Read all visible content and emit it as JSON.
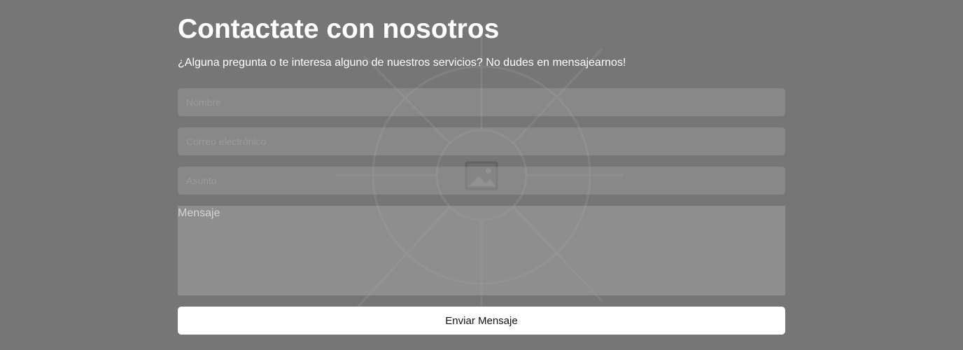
{
  "contact": {
    "title": "Contactate con nosotros",
    "subtitle": "¿Alguna pregunta o te interesa alguno de nuestros servicios? No dudes en mensajearnos!",
    "form": {
      "name_placeholder": "Nombre",
      "email_placeholder": "Correo electrónico",
      "subject_placeholder": "Asunto",
      "message_placeholder": "Mensaje",
      "submit_label": "Enviar Mensaje"
    }
  },
  "background": {
    "icon": "image-placeholder-icon",
    "overlay_color": "#767676"
  }
}
